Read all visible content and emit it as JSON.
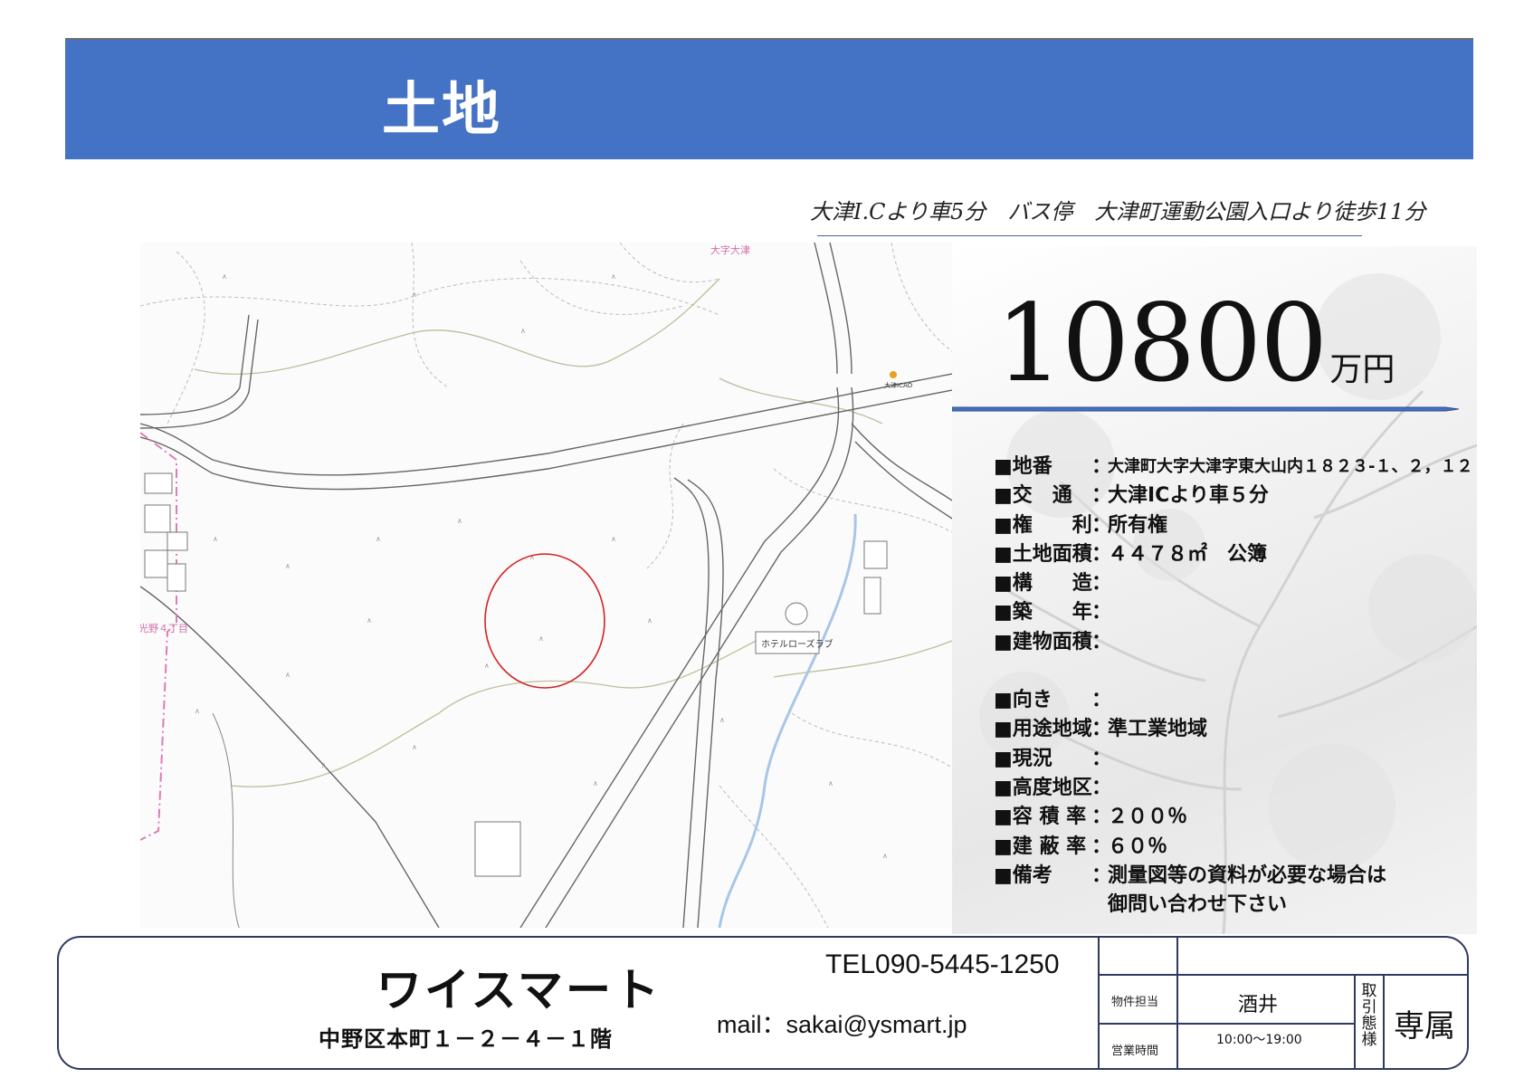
{
  "header": {
    "title": "土地"
  },
  "access_text": "大津I.Cより車5分　バス停　大津町運動公園入口より徒歩11分",
  "map": {
    "labels": [
      "大字大津",
      "大津ICAO",
      "ホテルローズラブ",
      "光野４丁目"
    ]
  },
  "price": {
    "amount": "10800",
    "unit": "万円"
  },
  "details": [
    {
      "label": "■地番",
      "sep": "：",
      "value": "大津町大字大津字東大山内１８２３-１、２，１２"
    },
    {
      "label": "■交　通",
      "sep": "：",
      "value": "大津ICより車５分"
    },
    {
      "label": "■権　　利",
      "sep": "：",
      "value": "所有権"
    },
    {
      "label": "■土地面積",
      "sep": "：",
      "value": "４４７８㎡　公簿"
    },
    {
      "label": "■構　　造",
      "sep": "：",
      "value": ""
    },
    {
      "label": "■築　　年",
      "sep": "：",
      "value": ""
    },
    {
      "label": "■建物面積",
      "sep": "：",
      "value": ""
    },
    {
      "label": "■向き",
      "sep": "：",
      "value": ""
    },
    {
      "label": "■用途地域",
      "sep": "：",
      "value": "準工業地域"
    },
    {
      "label": "■現況",
      "sep": "：",
      "value": ""
    },
    {
      "label": "■高度地区",
      "sep": "：",
      "value": ""
    },
    {
      "label": "■容 積 率",
      "sep": "：",
      "value": "２００％"
    },
    {
      "label": "■建 蔽 率",
      "sep": "：",
      "value": "６０％"
    },
    {
      "label": "■備考",
      "sep": "：",
      "value": "測量図等の資料が必要な場合は"
    }
  ],
  "details_note_line2": "御問い合わせ下さい",
  "footer": {
    "company": "ワイスマート",
    "address": "中野区本町１－２－４－１階",
    "tel": "TEL090-5445-1250",
    "mail": "mail：sakai@ysmart.jp",
    "staff_label": "物件担当",
    "staff_name": "酒井",
    "hours_label": "営業時間",
    "hours": "10:00～19:00",
    "deal_label": "取引態様",
    "deal_type": "専属"
  }
}
